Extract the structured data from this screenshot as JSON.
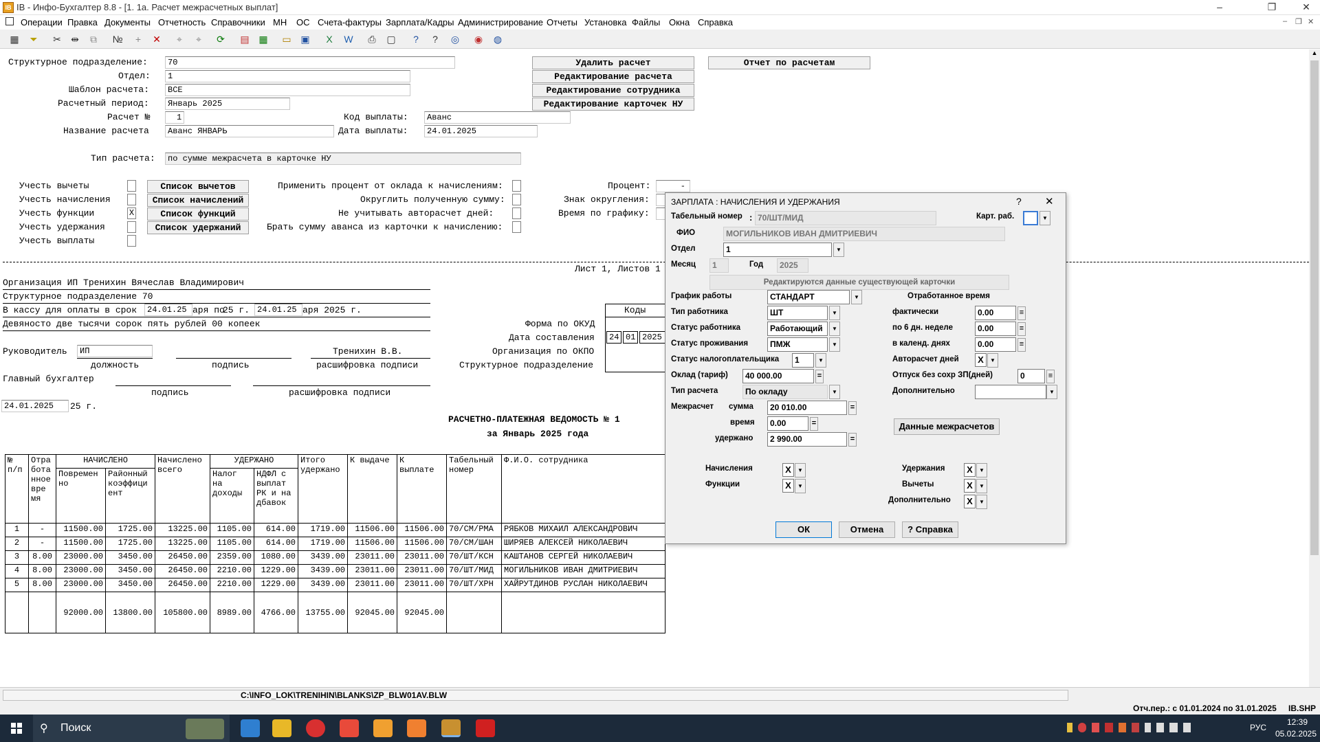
{
  "window": {
    "title": "IB - Инфо-Бухгалтер 8.8 - [1. 1а. Расчет межрасчетных выплат]",
    "app_icon": "IB"
  },
  "menu": [
    "Операции",
    "Правка",
    "Документы",
    "Отчетность",
    "Справочники",
    "МН",
    "ОС",
    "Счета-фактуры",
    "Зарплата/Кадры",
    "Администрирование",
    "Отчеты",
    "Установка",
    "Файлы",
    "Окна",
    "Справка"
  ],
  "form": {
    "struct_label": "Структурное подразделение:",
    "struct_value": "70",
    "dept_label": "Отдел:",
    "dept_value": "1",
    "template_label": "Шаблон расчета:",
    "template_value": "ВСЕ",
    "period_label": "Расчетный период:",
    "period_value": "Январь 2025",
    "calcno_label": "Расчет №",
    "calcno_value": "1",
    "paycode_label": "Код выплаты:",
    "paycode_value": "Аванс",
    "calcname_label": "Название расчета",
    "calcname_value": "Аванс ЯНВАРЬ",
    "paydate_label": "Дата выплаты:",
    "paydate_value": "24.01.2025",
    "calctype_label": "Тип расчета:",
    "calctype_value": "по сумме межрасчета в карточке НУ",
    "btn_delete": "Удалить расчет",
    "btn_edit_calc": "Редактирование расчета",
    "btn_edit_emp": "Редактирование сотрудника",
    "btn_edit_cards": "Редактирование карточек НУ",
    "btn_report": "Отчет по расчетам",
    "chk_deduct_label": "Учесть вычеты",
    "chk_accrual_label": "Учесть начисления",
    "chk_func_label": "Учесть функции",
    "chk_func_value": "X",
    "chk_hold_label": "Учесть удержания",
    "chk_pay_label": "Учесть выплаты",
    "btn_deduct_list": "Список вычетов",
    "btn_accrual_list": "Список начислений",
    "btn_func_list": "Список функций",
    "btn_hold_list": "Список удержаний",
    "opt1": "Применить процент от оклада к начислениям:",
    "opt2": "Округлить полученную сумму:",
    "opt3": "Не учитывать авторасчет дней:",
    "opt4": "Брать сумму аванса из карточки к начислению:",
    "pct_label": "Процент:",
    "pct_value": "-",
    "round_label": "Знак округления:",
    "sched_label": "Время по графику:"
  },
  "report": {
    "sheet": "Лист 1, Листов 1",
    "org": "Организация  ИП Тренихин Вячеслав Владимирович",
    "struct": "Структурное подразделение 70",
    "cash_a": "В кассу для оплаты в срок",
    "cash_d1": "24.01.25",
    "cash_b": "аря по",
    "cash_c": "25 г.",
    "cash_d2": "24.01.25",
    "cash_e": "аря 2025 г.",
    "amount_words": "Девяносто две тысячи сорок пять рублей 00 копеек",
    "codes_hdr": "Коды",
    "okud_label": "Форма по ОКУД",
    "compdate_label": "Дата составления",
    "compdate_d": "24",
    "compdate_m": "01",
    "compdate_y": "2025",
    "okpo_label": "Организация по ОКПО",
    "struct_label": "Структурное подразделение",
    "head_label": "Руководитель",
    "head_pos": "ИП",
    "head_name": "Тренихин В.В.",
    "pos_caption": "должность",
    "sig_caption": "подпись",
    "decode_caption": "расшифровка подписи",
    "chief_label": "Главный бухгалтер",
    "sig_caption2": "подпись",
    "decode_caption2": "расшифровка подписи",
    "date_val": "24.01.2025",
    "date_tail": "25 г.",
    "doc_title": "РАСЧЕТНО-ПЛАТЕЖНАЯ ВЕДОМОСТЬ № 1",
    "doc_sub": "за Январь 2025 года",
    "col_no": "№\nп/п",
    "col_time": "Отра\nбота\nнное\nвре\nмя",
    "col_accr": "НАЧИСЛЕНО",
    "col_accr1": "Повремен\nно",
    "col_accr2": "Районный\nкоэффици\nент",
    "col_accr_total": "Начислено\nвсего",
    "col_held": "УДЕРЖАНО",
    "col_held1": "Налог\nна\nдоходы",
    "col_held2": "НДФЛ с\nвыплат\nРК и на\nдбавок",
    "col_held_total": "Итого\nудержано",
    "col_issue": "К выдаче",
    "col_pay": "К\nвыплате",
    "col_tab": "Табельный\nномер",
    "col_fio": "Ф.И.О. сотрудника",
    "rows": [
      [
        "1",
        "-",
        "11500.00",
        "1725.00",
        "13225.00",
        "1105.00",
        "614.00",
        "1719.00",
        "11506.00",
        "11506.00",
        "70/СМ/РМА",
        "РЯБКОВ МИХАИЛ АЛЕКСАНДРОВИЧ"
      ],
      [
        "2",
        "-",
        "11500.00",
        "1725.00",
        "13225.00",
        "1105.00",
        "614.00",
        "1719.00",
        "11506.00",
        "11506.00",
        "70/СМ/ШАН",
        "ШИРЯЕВ АЛЕКСЕЙ НИКОЛАЕВИЧ"
      ],
      [
        "3",
        "8.00",
        "23000.00",
        "3450.00",
        "26450.00",
        "2359.00",
        "1080.00",
        "3439.00",
        "23011.00",
        "23011.00",
        "70/ШТ/КСН",
        "КАШТАНОВ СЕРГЕЙ НИКОЛАЕВИЧ"
      ],
      [
        "4",
        "8.00",
        "23000.00",
        "3450.00",
        "26450.00",
        "2210.00",
        "1229.00",
        "3439.00",
        "23011.00",
        "23011.00",
        "70/ШТ/МИД",
        "МОГИЛЬНИКОВ ИВАН ДМИТРИЕВИЧ"
      ],
      [
        "5",
        "8.00",
        "23000.00",
        "3450.00",
        "26450.00",
        "2210.00",
        "1229.00",
        "3439.00",
        "23011.00",
        "23011.00",
        "70/ШТ/ХРН",
        "ХАЙРУТДИНОВ РУСЛАН НИКОЛАЕВИЧ"
      ]
    ],
    "totals": [
      "",
      "",
      "92000.00",
      "13800.00",
      "105800.00",
      "8989.00",
      "4766.00",
      "13755.00",
      "92045.00",
      "92045.00",
      "",
      ""
    ]
  },
  "dialog": {
    "title": "ЗАРПЛАТА : НАЧИСЛЕНИЯ И УДЕРЖАНИЯ",
    "help_glyph": "?",
    "close_glyph": "✕",
    "tab_label": "Табельный номер",
    "tab_value": "70/ШТ/МИД",
    "card_label": "Карт. раб.",
    "fio_label": "ФИО",
    "fio_value": "МОГИЛЬНИКОВ ИВАН ДМИТРИЕВИЧ",
    "dept_label": "Отдел",
    "dept_value": "1",
    "month_label": "Месяц",
    "month_value": "1",
    "year_label": "Год",
    "year_value": "2025",
    "notice": "Редактируются данные существующей карточки",
    "sched_label": "График работы",
    "sched_value": "СТАНДАРТ",
    "type_label": "Тип работника",
    "type_value": "ШТ",
    "status_label": "Статус работника",
    "status_value": "Работающий",
    "resid_label": "Статус проживания",
    "resid_value": "ПМЖ",
    "taxstat_label": "Статус налогоплательщика",
    "taxstat_value": "1",
    "salary_label": "Оклад (тариф)",
    "salary_value": "40 000.00",
    "calctype_label": "Тип расчета",
    "calctype_value": "По окладу",
    "inter_label": "Межрасчет",
    "sum_label": "сумма",
    "sum_value": "20 010.00",
    "time_label": "время",
    "time_value": "0.00",
    "held_label": "удержано",
    "held_value": "2 990.00",
    "worked_hdr": "Отработанное время",
    "fact_label": "фактически",
    "fact_value": "0.00",
    "week6_label": "по 6 дн. неделе",
    "week6_value": "0.00",
    "cal_label": "в календ. днях",
    "cal_value": "0.00",
    "auto_label": "Авторасчет дней",
    "auto_value": "X",
    "leave_label": "Отпуск без сохр ЗП(дней)",
    "leave_value": "0",
    "extra_label": "Дополнительно",
    "extra_value": "",
    "btn_inter": "Данные межрасчетов",
    "accr_label": "Начисления",
    "accr_value": "X",
    "func_label": "Функции",
    "func_value": "X",
    "hold_label": "Удержания",
    "hold_value": "X",
    "deduct_label": "Вычеты",
    "deduct_value": "X",
    "add_label": "Дополнительно",
    "add_value": "X",
    "btn_ok": "ОК",
    "btn_cancel": "Отмена",
    "btn_help": "? Справка"
  },
  "status": {
    "path": "C:\\INFO_LOK\\TRENIHIN\\BLANKS\\ZP_BLW01AV.BLW",
    "period": "Отч.пер.: с 01.01.2024 по 31.01.2025",
    "db": "IB.SHP"
  },
  "taskbar": {
    "search": "Поиск",
    "lang": "РУС",
    "time": "12:39",
    "date": "05.02.2025"
  },
  "colors": {
    "taskbar": "#1c2a3a",
    "dialog_bg": "#f0f0f0",
    "toolbar": "#f0f0f0"
  }
}
